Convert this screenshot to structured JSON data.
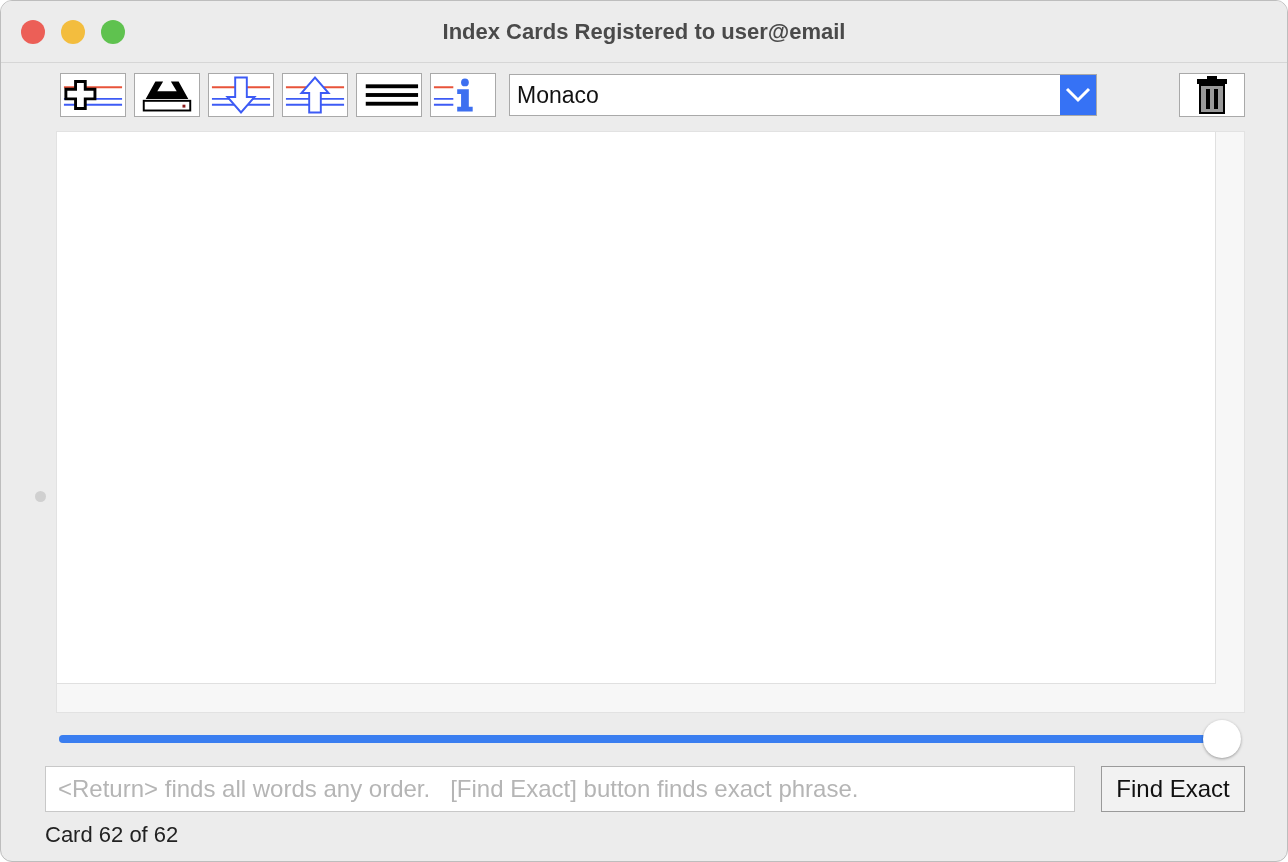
{
  "window": {
    "title": "Index Cards Registered to user@email"
  },
  "toolbar": {
    "font_select": {
      "value": "Monaco"
    }
  },
  "card_slider": {
    "level": 1.0
  },
  "search": {
    "placeholder": "<Return> finds all words any order.   [Find Exact] button finds exact phrase.",
    "button": "Find Exact"
  },
  "status_bar": "Card 62 of 62"
}
